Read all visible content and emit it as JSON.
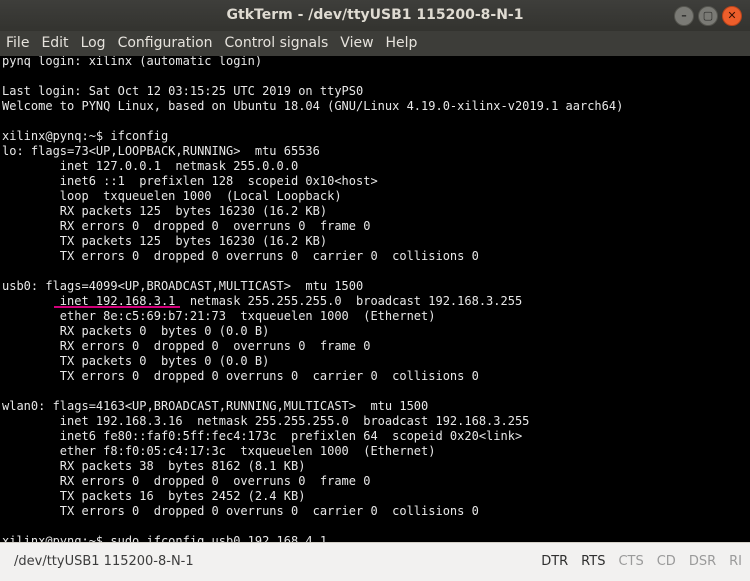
{
  "window": {
    "title": "GtkTerm - /dev/ttyUSB1  115200-8-N-1",
    "controls": [
      "–",
      "▢",
      "✕"
    ]
  },
  "menu": [
    "File",
    "Edit",
    "Log",
    "Configuration",
    "Control signals",
    "View",
    "Help"
  ],
  "terminal": {
    "lines": [
      "pynq login: xilinx (automatic login)",
      "",
      "Last login: Sat Oct 12 03:15:25 UTC 2019 on ttyPS0",
      "Welcome to PYNQ Linux, based on Ubuntu 18.04 (GNU/Linux 4.19.0-xilinx-v2019.1 aarch64)",
      "",
      "xilinx@pynq:~$ ifconfig",
      "lo: flags=73<UP,LOOPBACK,RUNNING>  mtu 65536",
      "        inet 127.0.0.1  netmask 255.0.0.0",
      "        inet6 ::1  prefixlen 128  scopeid 0x10<host>",
      "        loop  txqueuelen 1000  (Local Loopback)",
      "        RX packets 125  bytes 16230 (16.2 KB)",
      "        RX errors 0  dropped 0  overruns 0  frame 0",
      "        TX packets 125  bytes 16230 (16.2 KB)",
      "        TX errors 0  dropped 0 overruns 0  carrier 0  collisions 0",
      "",
      "usb0: flags=4099<UP,BROADCAST,MULTICAST>  mtu 1500",
      "        inet 192.168.3.1  netmask 255.255.255.0  broadcast 192.168.3.255",
      "        ether 8e:c5:69:b7:21:73  txqueuelen 1000  (Ethernet)",
      "        RX packets 0  bytes 0 (0.0 B)",
      "        RX errors 0  dropped 0  overruns 0  frame 0",
      "        TX packets 0  bytes 0 (0.0 B)",
      "        TX errors 0  dropped 0 overruns 0  carrier 0  collisions 0",
      "",
      "wlan0: flags=4163<UP,BROADCAST,RUNNING,MULTICAST>  mtu 1500",
      "        inet 192.168.3.16  netmask 255.255.255.0  broadcast 192.168.3.255",
      "        inet6 fe80::faf0:5ff:fec4:173c  prefixlen 64  scopeid 0x20<link>",
      "        ether f8:f0:05:c4:17:3c  txqueuelen 1000  (Ethernet)",
      "        RX packets 38  bytes 8162 (8.1 KB)",
      "        RX errors 0  dropped 0  overruns 0  frame 0",
      "        TX packets 16  bytes 2452 (2.4 KB)",
      "        TX errors 0  dropped 0 overruns 0  carrier 0  collisions 0",
      "",
      "xilinx@pynq:~$ sudo ifconfig usb0 192.168.4.1"
    ]
  },
  "status": {
    "port": "/dev/ttyUSB1  115200-8-N-1",
    "signals": [
      {
        "label": "DTR",
        "active": true
      },
      {
        "label": "RTS",
        "active": true
      },
      {
        "label": "CTS",
        "active": false
      },
      {
        "label": "CD",
        "active": false
      },
      {
        "label": "DSR",
        "active": false
      },
      {
        "label": "RI",
        "active": false
      }
    ]
  }
}
